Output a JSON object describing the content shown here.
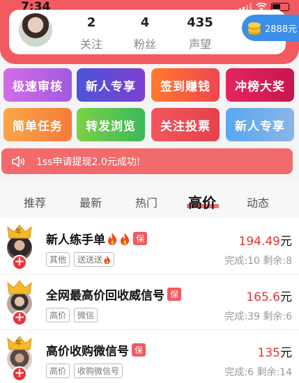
{
  "status_bar": {
    "time": "7:34"
  },
  "profile": {
    "stats": [
      {
        "value": "2",
        "label": "关注"
      },
      {
        "value": "4",
        "label": "粉丝"
      },
      {
        "value": "435",
        "label": "声望"
      }
    ],
    "coins": "2888元"
  },
  "grid": [
    {
      "label": "极速审核",
      "color_from": "#d16ee8",
      "color_to": "#a25ae0"
    },
    {
      "label": "新人专享",
      "color_from": "#4b55d6",
      "color_to": "#7d3fd0"
    },
    {
      "label": "签到赚钱",
      "color_from": "#ff7a2c",
      "color_to": "#f14550"
    },
    {
      "label": "冲榜大奖",
      "color_from": "#e4255d",
      "color_to": "#c9154e"
    },
    {
      "label": "简单任务",
      "color_from": "#f9a64a",
      "color_to": "#f57c3a"
    },
    {
      "label": "转发浏览",
      "color_from": "#7ad145",
      "color_to": "#3cb85a"
    },
    {
      "label": "关注投票",
      "color_from": "#f2565c",
      "color_to": "#e5414c"
    },
    {
      "label": "新人专享",
      "color_from": "#58a8ef",
      "color_to": "#8bb4e6"
    }
  ],
  "notice": {
    "text": "1ss申请提现2.0元成功!"
  },
  "tabs": [
    {
      "label": "推荐"
    },
    {
      "label": "最新"
    },
    {
      "label": "热门"
    },
    {
      "label": "高价",
      "active": true
    },
    {
      "label": "动态"
    }
  ],
  "tasks": [
    {
      "title": "新人练手单",
      "flames": 2,
      "badge": "保",
      "tags": [
        "其他",
        "送送送"
      ],
      "tag_flame_index": 1,
      "price": "194.49",
      "unit": "元",
      "remain": "完成:10 剩余:8",
      "crown_text": "年"
    },
    {
      "title": "全网最高价回收威信号",
      "flames": 0,
      "badge": "保",
      "tags": [
        "高价",
        "微信"
      ],
      "tag_flame_index": -1,
      "price": "165.6",
      "unit": "元",
      "remain": "完成:39 剩余:6",
      "crown_text": "年"
    },
    {
      "title": "高价收购微信号",
      "flames": 0,
      "badge": "保",
      "tags": [
        "高价",
        "收购微信号"
      ],
      "tag_flame_index": -1,
      "price": "135",
      "unit": "元",
      "remain": "完成:6 剩余:14",
      "crown_text": "年"
    }
  ],
  "icons": {
    "coin": "coin-stack-icon",
    "notice": "speaker-icon",
    "add": "plus-icon",
    "crown": "crown-icon",
    "flame": "flame-icon"
  }
}
